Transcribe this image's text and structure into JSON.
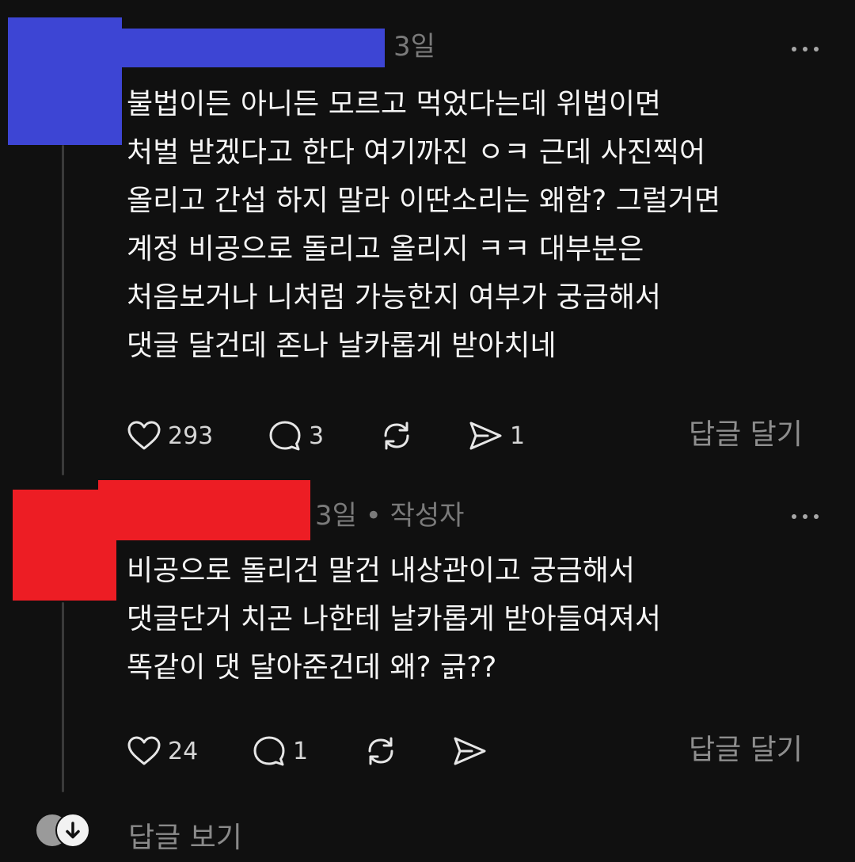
{
  "comments": [
    {
      "time": "3일",
      "lines": [
        "불법이든 아니든 모르고 먹었다는데 위법이면",
        "처벌 받겠다고 한다 여기까진 ㅇㅋ 근데  사진찍어",
        "올리고 간섭 하지 말라 이딴소리는 왜함? 그럴거면",
        "계정 비공으로 돌리고 올리지 ㅋㅋ 대부분은",
        "처음보거나 니처럼 가능한지 여부가 궁금해서",
        "댓글 달건데 존나 날카롭게 받아치네"
      ],
      "likes": "293",
      "replies": "3",
      "shares": "1",
      "reply_label": "답글 달기"
    },
    {
      "time": "3일 • 작성자",
      "lines": [
        "비공으로 돌리건 말건 내상관이고 궁금해서",
        "댓글단거 치곤 나한테 날카롭게 받아들여져서",
        "똑같이 댓 달아준건데 왜? 긁??"
      ],
      "likes": "24",
      "replies": "1",
      "reply_label": "답글 달기"
    }
  ],
  "view_replies_label": "답글 보기",
  "icons": {
    "like": "heart-icon",
    "reply": "speech-bubble-icon",
    "repost": "repost-icon",
    "share": "send-icon",
    "more": "more-dots-icon",
    "expand": "arrow-down-icon"
  },
  "colors": {
    "background": "#101010",
    "redaction_1": "#3d45d4",
    "redaction_2": "#ed1d24"
  }
}
